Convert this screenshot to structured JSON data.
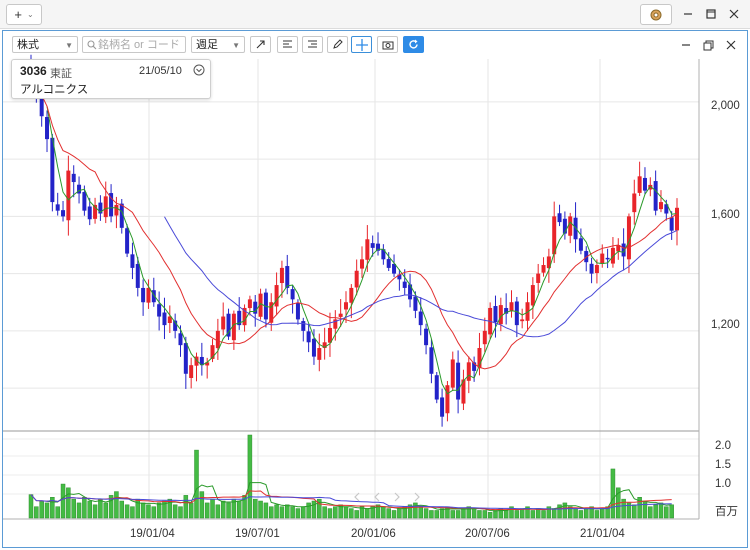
{
  "app": {
    "new_button": "+",
    "settings_icon": "gear-icon"
  },
  "toolbar": {
    "market_select": "株式",
    "search_placeholder": "銘柄名 or コード",
    "period_select": "週足",
    "buttons": [
      "trendline-icon",
      "align-left-icon",
      "align-right-icon",
      "pencil-icon",
      "crosshair-icon",
      "camera-icon",
      "refresh-icon"
    ]
  },
  "info": {
    "code": "3036",
    "exchange": "東証",
    "date": "21/05/10",
    "name": "アルコニクス"
  },
  "axes": {
    "price_ticks": [
      "2,000",
      "1,600",
      "1,200"
    ],
    "volume_ticks": [
      "2.0",
      "1.5",
      "1.0"
    ],
    "volume_unit": "百万",
    "x_ticks": [
      "19/01/04",
      "19/07/01",
      "20/01/06",
      "20/07/06",
      "21/01/04"
    ]
  },
  "colors": {
    "up": "#e8242a",
    "down": "#2323c8",
    "ma_short": "#2a9a2a",
    "ma_mid": "#e23030",
    "ma_long": "#4a4ad8",
    "volume": "#44bb44",
    "accent": "#2e8be6"
  },
  "chart_data": {
    "type": "candlestick",
    "period": "weekly",
    "x_range": [
      "2018-06",
      "2021-05-10"
    ],
    "price_ylim": [
      850,
      2150
    ],
    "volume_ylim": [
      0,
      2.2
    ],
    "volume_unit": "百万",
    "closes_weekly": [
      2090,
      2030,
      1950,
      1870,
      1650,
      1620,
      1600,
      1760,
      1720,
      1680,
      1620,
      1590,
      1640,
      1610,
      1670,
      1600,
      1640,
      1560,
      1470,
      1420,
      1350,
      1300,
      1350,
      1300,
      1250,
      1220,
      1250,
      1200,
      1150,
      1050,
      1080,
      1110,
      1080,
      1090,
      1150,
      1200,
      1250,
      1180,
      1260,
      1220,
      1280,
      1310,
      1260,
      1330,
      1240,
      1300,
      1360,
      1420,
      1350,
      1310,
      1240,
      1200,
      1160,
      1110,
      1140,
      1160,
      1210,
      1240,
      1260,
      1300,
      1350,
      1410,
      1450,
      1520,
      1490,
      1480,
      1450,
      1420,
      1400,
      1380,
      1350,
      1310,
      1270,
      1220,
      1150,
      1050,
      960,
      900,
      1010,
      1100,
      960,
      1030,
      1090,
      1060,
      1140,
      1200,
      1280,
      1230,
      1290,
      1260,
      1300,
      1220,
      1240,
      1300,
      1360,
      1400,
      1430,
      1460,
      1600,
      1580,
      1540,
      1600,
      1520,
      1480,
      1440,
      1400,
      1430,
      1470,
      1450,
      1490,
      1500,
      1460,
      1600,
      1680,
      1740,
      1690,
      1710,
      1620,
      1650,
      1610,
      1550,
      1630
    ],
    "volumes_weekly": [
      0.62,
      0.3,
      0.45,
      0.4,
      0.55,
      0.3,
      0.9,
      0.8,
      0.5,
      0.4,
      0.55,
      0.45,
      0.35,
      0.5,
      0.4,
      0.6,
      0.7,
      0.45,
      0.35,
      0.3,
      0.5,
      0.4,
      0.35,
      0.3,
      0.4,
      0.45,
      0.5,
      0.35,
      0.3,
      0.6,
      0.4,
      1.8,
      0.7,
      0.4,
      0.5,
      0.35,
      0.45,
      0.4,
      0.5,
      0.45,
      0.6,
      2.2,
      0.5,
      0.45,
      0.4,
      0.3,
      0.35,
      0.3,
      0.35,
      0.3,
      0.25,
      0.3,
      0.4,
      0.45,
      0.5,
      0.3,
      0.25,
      0.3,
      0.35,
      0.3,
      0.25,
      0.2,
      0.3,
      0.25,
      0.3,
      0.35,
      0.3,
      0.25,
      0.2,
      0.25,
      0.3,
      0.35,
      0.4,
      0.3,
      0.25,
      0.2,
      0.2,
      0.25,
      0.3,
      0.2,
      0.2,
      0.25,
      0.3,
      0.25,
      0.2,
      0.2,
      0.15,
      0.2,
      0.25,
      0.2,
      0.3,
      0.2,
      0.25,
      0.3,
      0.2,
      0.25,
      0.2,
      0.3,
      0.25,
      0.35,
      0.4,
      0.3,
      0.25,
      0.2,
      0.25,
      0.3,
      0.2,
      0.25,
      0.3,
      1.3,
      0.8,
      0.5,
      0.4,
      0.35,
      0.55,
      0.45,
      0.3,
      0.35,
      0.4,
      0.3,
      0.35
    ]
  }
}
